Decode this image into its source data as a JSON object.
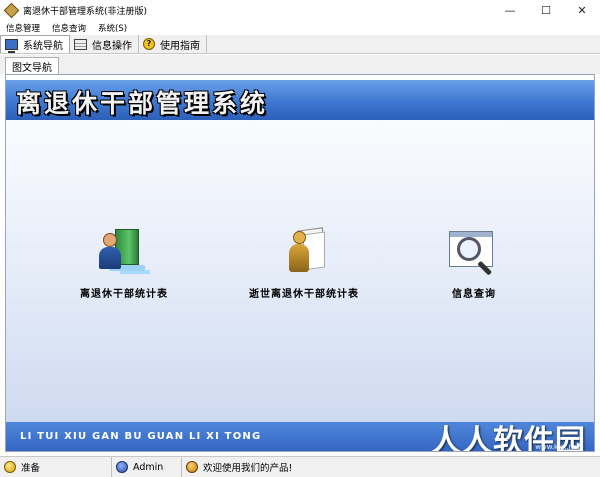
{
  "window": {
    "title": "离退休干部管理系统(非注册版)",
    "controls": [
      "—",
      "☐",
      "✕"
    ]
  },
  "menu": [
    "信息管理",
    "信息查询",
    "系统(S)"
  ],
  "toolbar": [
    {
      "label": "系统导航",
      "icon": "monitor-icon",
      "active": true
    },
    {
      "label": "信息操作",
      "icon": "grid-icon",
      "active": false
    },
    {
      "label": "使用指南",
      "icon": "help-icon",
      "active": false
    }
  ],
  "subtab": {
    "label": "图文导航"
  },
  "banner": {
    "title": "离退休干部管理系统"
  },
  "nav": [
    {
      "label": "离退休干部统计表",
      "icon": "retiree-stats-icon"
    },
    {
      "label": "逝世离退休干部统计表",
      "icon": "deceased-stats-icon"
    },
    {
      "label": "信息查询",
      "icon": "search-icon"
    }
  ],
  "footer": {
    "pinyin": "LI TUI XIU GAN BU GUAN LI XI TONG",
    "watermark": "人人软件园",
    "watermark_url": "www.kkx.net"
  },
  "status": [
    {
      "label": "准备",
      "icon": "ready-icon"
    },
    {
      "label": "Admin",
      "icon": "admin-icon"
    },
    {
      "label": "欢迎使用我们的产品!",
      "icon": "welcome-icon"
    }
  ],
  "colors": {
    "banner": "#3f78d2",
    "footer": "#3366c2"
  }
}
